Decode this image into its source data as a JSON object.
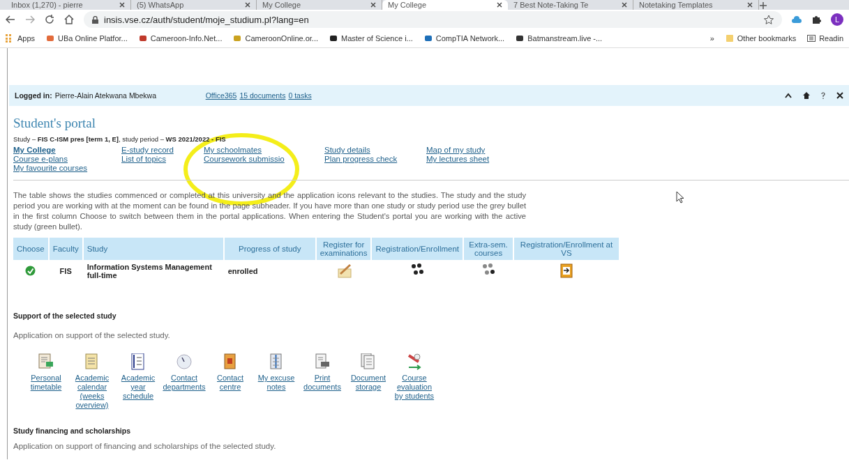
{
  "browser": {
    "tabs": [
      {
        "title": "Inbox (1,270) - pierre",
        "selected": false
      },
      {
        "title": "(5) WhatsApp",
        "selected": false
      },
      {
        "title": "My College",
        "selected": false
      },
      {
        "title": "My College",
        "selected": true
      },
      {
        "title": "7 Best Note-Taking Te",
        "selected": false
      },
      {
        "title": "Notetaking Templates",
        "selected": false
      }
    ],
    "address": "insis.vse.cz/auth/student/moje_studium.pl?lang=en",
    "bookmarks": [
      "Apps",
      "UBa Online Platfor...",
      "Cameroon-Info.Net...",
      "CameroonOnline.or...",
      "Master of Science i...",
      "CompTIA Network...",
      "Batmanstream.live -..."
    ],
    "more_bookmarks": "»",
    "other_bookmarks": "Other bookmarks",
    "reading_list": "Readin",
    "profile_initial": "L"
  },
  "top_bar": {
    "label": "Logged in:",
    "user": "Pierre-Alain Atekwana Mbekwa",
    "links": [
      "Office365",
      "15 documents",
      "0 tasks"
    ]
  },
  "portal": {
    "title": "Student's portal",
    "subheader": "Study – **FIS C-ISM pres [term 1, E]**, study period – **WS 2021/2022 - FIS**",
    "menu": [
      [
        "My College",
        "Course e-plans",
        "My favourite courses"
      ],
      [
        "E-study record",
        "List of topics"
      ],
      [
        "My schoolmates",
        "Coursework submissio"
      ],
      [
        "Study details",
        "Plan progress check"
      ],
      [
        "Map of my study",
        "My lectures sheet"
      ]
    ],
    "intro": "The table shows the studies commenced or completed at this university and the application icons relevant to the studies. The study and the study period you are working with at the moment can be found in the page subheader. If you have more than one study or study period use the grey bullet in the first column Choose to switch between them in the portal applications. When entering the Student's portal you are working with the active study (green bullet).",
    "table": {
      "columns": [
        "Choose",
        "Faculty",
        "Study",
        "Progress of study",
        "Register for examinations",
        "Registration/Enrollment",
        "Extra-sem. courses",
        "Registration/Enrollment at VS"
      ],
      "rows": [
        {
          "selected": true,
          "faculty": "FIS",
          "study": "Information Systems Management",
          "form": "full-time",
          "progress": "enrolled"
        }
      ]
    },
    "support": {
      "heading": "Support of the selected study",
      "note": "Application on support of the selected study.",
      "apps": [
        "Personal timetable",
        "Academic calendar (weeks overview)",
        "Academic year schedule",
        "Contact departments",
        "Contact centre",
        "My excuse notes",
        "Print documents",
        "Document storage",
        "Course evaluation by students"
      ]
    },
    "financing": {
      "heading": "Study financing and scholarships",
      "note": "Application on support of financing and scholarships of the selected study."
    }
  }
}
